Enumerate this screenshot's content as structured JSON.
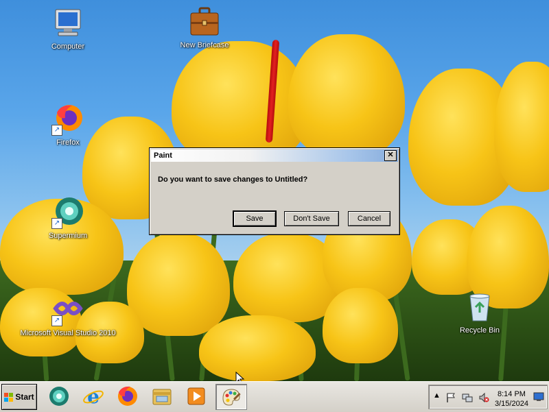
{
  "desktop": {
    "icons": [
      {
        "label": "Computer",
        "icon": "computer-icon",
        "shortcut": false
      },
      {
        "label": "New Briefcase",
        "icon": "briefcase-icon",
        "shortcut": false
      },
      {
        "label": "Firefox",
        "icon": "firefox-icon",
        "shortcut": true
      },
      {
        "label": "Supermium",
        "icon": "supermium-icon",
        "shortcut": true
      },
      {
        "label": "Microsoft Visual Studio 2010",
        "icon": "visual-studio-icon",
        "shortcut": true
      },
      {
        "label": "Recycle Bin",
        "icon": "recycle-bin-icon",
        "shortcut": false
      }
    ]
  },
  "dialog": {
    "title": "Paint",
    "close_label": "✕",
    "message": "Do you want to save changes to Untitled?",
    "buttons": {
      "save": "Save",
      "dont_save": "Don't Save",
      "cancel": "Cancel"
    }
  },
  "taskbar": {
    "start_label": "Start",
    "pinned": [
      {
        "name": "supermium-icon"
      },
      {
        "name": "internet-explorer-icon"
      },
      {
        "name": "firefox-icon"
      },
      {
        "name": "file-explorer-icon"
      },
      {
        "name": "media-player-icon"
      },
      {
        "name": "paint-icon",
        "active": true
      }
    ],
    "tray": {
      "icons": [
        "show-hidden-icons-chevron",
        "action-center-flag-icon",
        "network-icon",
        "volume-muted-icon"
      ],
      "time": "8:14 PM",
      "date": "3/15/2024"
    }
  },
  "colors": {
    "dialog_bg": "#d4d0c8",
    "taskbar_bg": "#d4d0c8",
    "sky": "#5aa6ea",
    "tulip": "#f7c417"
  }
}
